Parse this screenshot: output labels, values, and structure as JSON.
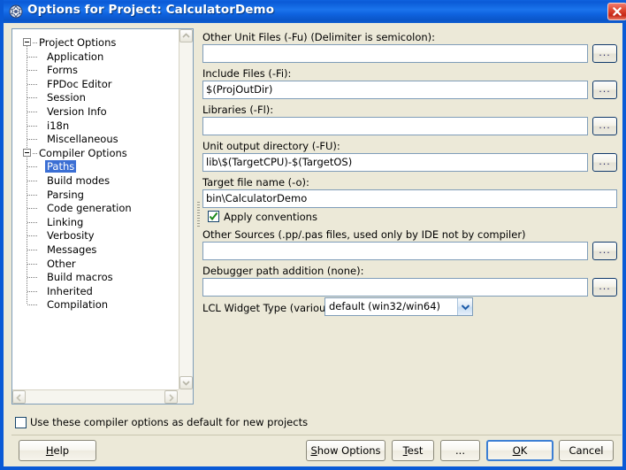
{
  "window": {
    "title": "Options for Project: CalculatorDemo",
    "icon": "app-icon",
    "close_label": "Close",
    "accent_titlebar": "#0a5ad6",
    "accent_selection": "#3b6fd4",
    "background": "#ece9d8"
  },
  "tree": {
    "nodes": [
      {
        "label": "Project Options",
        "level": 0,
        "expander": "minus",
        "selected": false
      },
      {
        "label": "Application",
        "level": 1,
        "expander": "none",
        "selected": false
      },
      {
        "label": "Forms",
        "level": 1,
        "expander": "none",
        "selected": false
      },
      {
        "label": "FPDoc Editor",
        "level": 1,
        "expander": "none",
        "selected": false
      },
      {
        "label": "Session",
        "level": 1,
        "expander": "none",
        "selected": false
      },
      {
        "label": "Version Info",
        "level": 1,
        "expander": "none",
        "selected": false
      },
      {
        "label": "i18n",
        "level": 1,
        "expander": "none",
        "selected": false
      },
      {
        "label": "Miscellaneous",
        "level": 1,
        "expander": "none",
        "selected": false
      },
      {
        "label": "Compiler Options",
        "level": 0,
        "expander": "minus",
        "selected": false
      },
      {
        "label": "Paths",
        "level": 1,
        "expander": "none",
        "selected": true
      },
      {
        "label": "Build modes",
        "level": 1,
        "expander": "none",
        "selected": false
      },
      {
        "label": "Parsing",
        "level": 1,
        "expander": "none",
        "selected": false
      },
      {
        "label": "Code generation",
        "level": 1,
        "expander": "none",
        "selected": false
      },
      {
        "label": "Linking",
        "level": 1,
        "expander": "none",
        "selected": false
      },
      {
        "label": "Verbosity",
        "level": 1,
        "expander": "none",
        "selected": false
      },
      {
        "label": "Messages",
        "level": 1,
        "expander": "none",
        "selected": false
      },
      {
        "label": "Other",
        "level": 1,
        "expander": "none",
        "selected": false
      },
      {
        "label": "Build macros",
        "level": 1,
        "expander": "none",
        "selected": false
      },
      {
        "label": "Inherited",
        "level": 1,
        "expander": "none",
        "selected": false
      },
      {
        "label": "Compilation",
        "level": 1,
        "expander": "none",
        "selected": false
      }
    ],
    "scroll_up_icon": "chevron-up-icon",
    "scroll_down_icon": "chevron-down-icon",
    "scroll_left_icon": "chevron-left-icon",
    "scroll_right_icon": "chevron-right-icon"
  },
  "fields": {
    "other_unit_files": {
      "label": "Other Unit Files (-Fu) (Delimiter is semicolon):",
      "value": "",
      "browse_label": "..."
    },
    "include_files": {
      "label": "Include Files (-Fi):",
      "value": "$(ProjOutDir)",
      "browse_label": "..."
    },
    "libraries": {
      "label": "Libraries (-Fl):",
      "value": "",
      "browse_label": "..."
    },
    "unit_output_directory": {
      "label": "Unit output directory (-FU):",
      "value": "lib\\$(TargetCPU)-$(TargetOS)",
      "browse_label": "..."
    },
    "target_file_name": {
      "label": "Target file name (-o):",
      "value": "bin\\CalculatorDemo"
    },
    "apply_conventions": {
      "label": "Apply conventions",
      "checked": true
    },
    "other_sources": {
      "label": "Other Sources (.pp/.pas files, used only by IDE not by compiler)",
      "value": "",
      "browse_label": "..."
    },
    "debugger_path_addition": {
      "label": "Debugger path addition (none):",
      "value": "",
      "browse_label": "..."
    },
    "lcl_widget_type": {
      "label": "LCL Widget Type (various)",
      "selected": "default (win32/win64)",
      "options": [
        "default (win32/win64)"
      ]
    }
  },
  "bottom": {
    "default_checkbox": {
      "label": "Use these compiler options as default for new projects",
      "checked": false
    },
    "buttons": {
      "help": {
        "text": "Help",
        "accel": "H"
      },
      "show_options": {
        "text": "Show Options",
        "accel": "S"
      },
      "test": {
        "text": "Test",
        "accel": "T"
      },
      "more": {
        "text": "...",
        "accel": ""
      },
      "ok": {
        "text": "OK",
        "accel": "O"
      },
      "cancel": {
        "text": "Cancel",
        "accel": ""
      }
    }
  }
}
